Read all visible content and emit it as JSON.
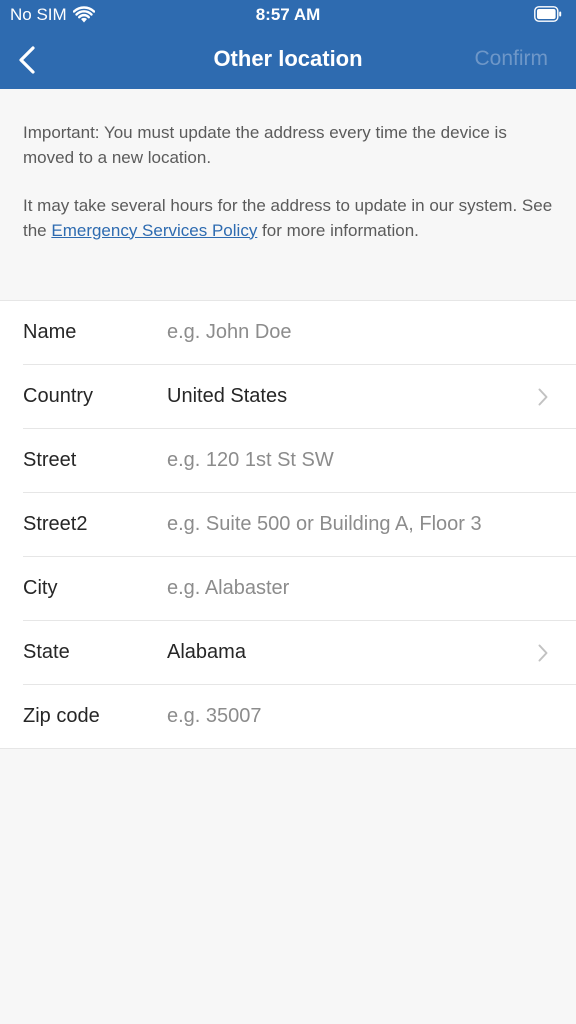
{
  "status": {
    "carrier": "No SIM",
    "time": "8:57 AM"
  },
  "nav": {
    "title": "Other location",
    "confirm_label": "Confirm",
    "back_icon": "chevron-left-icon"
  },
  "info": {
    "paragraph1": "Important: You must update the address every time the device is moved to a new location.",
    "paragraph2_before": "It may take several hours for the address to update in our system. See the ",
    "paragraph2_link": "Emergency Services Policy",
    "paragraph2_after": " for more information."
  },
  "form": {
    "name": {
      "label": "Name",
      "placeholder": "e.g. John Doe"
    },
    "country": {
      "label": "Country",
      "value": "United States"
    },
    "street": {
      "label": "Street",
      "placeholder": "e.g. 120 1st St SW"
    },
    "street2": {
      "label": "Street2",
      "placeholder": "e.g. Suite 500 or Building A, Floor 3"
    },
    "city": {
      "label": "City",
      "placeholder": "e.g. Alabaster"
    },
    "state": {
      "label": "State",
      "value": "Alabama"
    },
    "zip": {
      "label": "Zip code",
      "placeholder": "e.g. 35007"
    }
  },
  "colors": {
    "header_bg": "#2e6bb0",
    "link": "#2e6bb0",
    "confirm_disabled": "#6e97c8"
  }
}
